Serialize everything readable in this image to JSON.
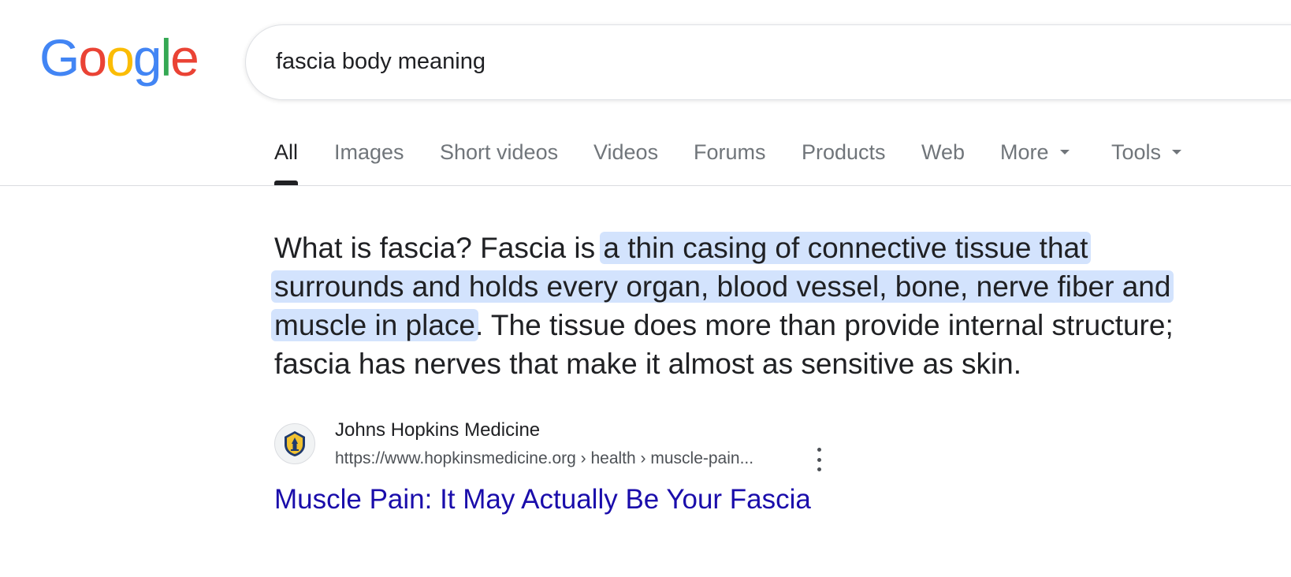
{
  "logo": {
    "letters": [
      "G",
      "o",
      "o",
      "g",
      "l",
      "e"
    ],
    "colors": [
      "#4285f4",
      "#ea4335",
      "#fbbc05",
      "#4285f4",
      "#34a853",
      "#ea4335"
    ]
  },
  "search": {
    "query": "fascia body meaning"
  },
  "tabs": [
    {
      "label": "All",
      "active": true
    },
    {
      "label": "Images"
    },
    {
      "label": "Short videos"
    },
    {
      "label": "Videos"
    },
    {
      "label": "Forums"
    },
    {
      "label": "Products"
    },
    {
      "label": "Web"
    },
    {
      "label": "More",
      "dropdown": true
    },
    {
      "label": "Tools",
      "dropdown": true
    }
  ],
  "snippet": {
    "prefix": "What is fascia? Fascia is ",
    "highlight": "a thin casing of connective tissue that surrounds and holds every organ, blood vessel, bone, nerve fiber and muscle in place",
    "suffix": ". The tissue does more than provide internal structure; fascia has nerves that make it almost as sensitive as skin."
  },
  "result": {
    "site_name": "Johns Hopkins Medicine",
    "url": "https://www.hopkinsmedicine.org › health › muscle-pain...",
    "title": "Muscle Pain: It May Actually Be Your Fascia",
    "favicon": "johns-hopkins-shield-icon"
  },
  "colors": {
    "link": "#1a0dab",
    "highlight": "#d3e3fd",
    "text": "#202124",
    "muted": "#70757a"
  }
}
